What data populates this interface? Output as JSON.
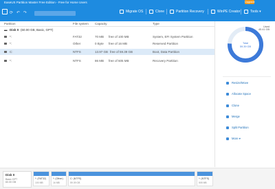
{
  "titlebar": {
    "title": "EaseUS Partition Master Free Edition - Free for Home Users",
    "upgrade": "Upgrade"
  },
  "toolbar": {
    "search_placeholder": "",
    "items": [
      {
        "label": "Migrate OS",
        "icon": "migrate-icon"
      },
      {
        "label": "Clone",
        "icon": "clone-icon"
      },
      {
        "label": "Partition Recovery",
        "icon": "recovery-icon"
      },
      {
        "label": "WinPE Creator",
        "icon": "winpe-icon"
      },
      {
        "label": "Tools",
        "icon": "tools-icon"
      }
    ]
  },
  "table": {
    "headers": [
      "Partition",
      "File system",
      "Capacity",
      "Type"
    ],
    "disk": {
      "name": "Disk 0",
      "info": "(60.00 GB, Basic, GPT)"
    },
    "rows": [
      {
        "name": "*:",
        "fs": "FAT32",
        "used": "70 MB",
        "free": "free of 100 MB",
        "type": "System, EFI System Partition"
      },
      {
        "name": "*:",
        "fs": "Other",
        "used": "0 Byte",
        "free": "free of 16 MB",
        "type": "Reserved Partition"
      },
      {
        "name": "C:",
        "fs": "NTFS",
        "used": "13.97 GB",
        "free": "free of 59.39 GB",
        "type": "Boot, Data Partition"
      },
      {
        "name": "*:",
        "fs": "NTFS",
        "used": "86 MB",
        "free": "free of 505 MB",
        "type": "Recovery Partition"
      }
    ]
  },
  "sidebar": {
    "used_label": "Used",
    "used_value": "45.41 GB",
    "donut_label": "Total",
    "donut_value": "59.39 GB",
    "used_fraction": 0.76,
    "actions": [
      {
        "label": "Resize/Move",
        "icon": "resize-icon"
      },
      {
        "label": "Allocate Space",
        "icon": "allocate-icon"
      },
      {
        "label": "Clone",
        "icon": "clone-icon"
      },
      {
        "label": "Merge",
        "icon": "merge-icon"
      },
      {
        "label": "Split Partition",
        "icon": "split-icon"
      },
      {
        "label": "More",
        "icon": "more-icon"
      }
    ]
  },
  "diskmap": {
    "disk": {
      "name": "Disk 0",
      "type": "Basic GPT",
      "size": "60.00 GB"
    },
    "segments": [
      {
        "label": "*: (FAT32)",
        "size": "100 MB"
      },
      {
        "label": "*: (Other)",
        "size": "16 MB"
      },
      {
        "label": "C: (NTFS)",
        "size": "59.39 GB"
      },
      {
        "label": "*: (NTFS)",
        "size": "505 MB"
      }
    ]
  },
  "colors": {
    "accent": "#1e8be0",
    "selected_row": "#dceaf8",
    "donut_used": "#3d7ad9",
    "donut_free": "#e3ecf6"
  }
}
